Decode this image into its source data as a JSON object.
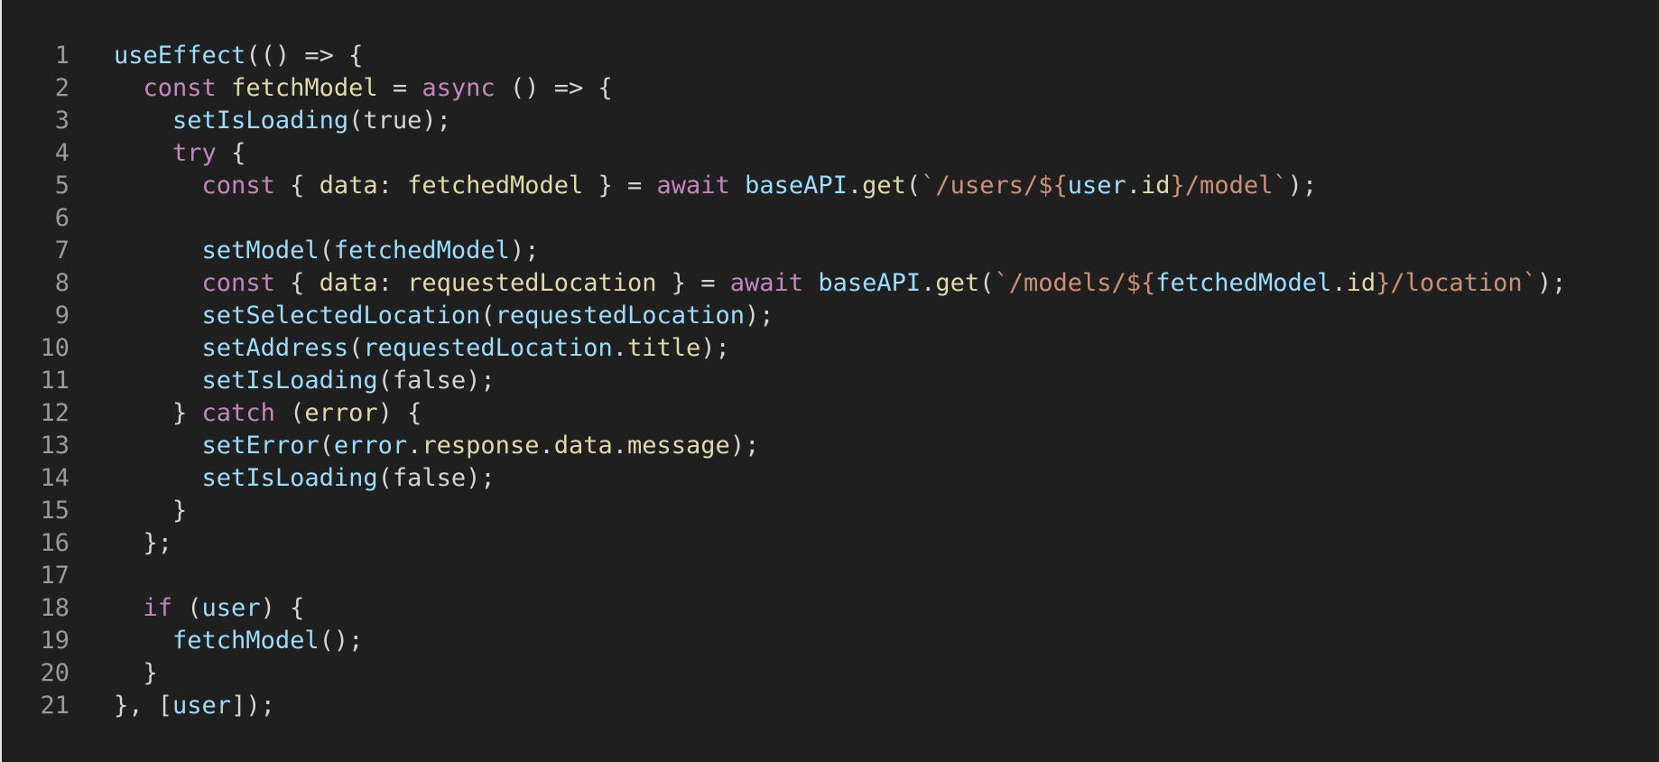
{
  "editor": {
    "lines": [
      {
        "n": "1",
        "tokens": [
          {
            "t": "useEffect",
            "c": "fn"
          },
          {
            "t": "(() => {",
            "c": "pun"
          }
        ]
      },
      {
        "n": "2",
        "tokens": [
          {
            "t": "  ",
            "c": "pun"
          },
          {
            "t": "const",
            "c": "kw"
          },
          {
            "t": " ",
            "c": "pun"
          },
          {
            "t": "fetchModel",
            "c": "var"
          },
          {
            "t": " = ",
            "c": "pun"
          },
          {
            "t": "async",
            "c": "kw"
          },
          {
            "t": " () => {",
            "c": "pun"
          }
        ]
      },
      {
        "n": "3",
        "tokens": [
          {
            "t": "    ",
            "c": "pun"
          },
          {
            "t": "setIsLoading",
            "c": "fn"
          },
          {
            "t": "(true);",
            "c": "pun"
          }
        ]
      },
      {
        "n": "4",
        "tokens": [
          {
            "t": "    ",
            "c": "pun"
          },
          {
            "t": "try",
            "c": "kw"
          },
          {
            "t": " {",
            "c": "pun"
          }
        ]
      },
      {
        "n": "5",
        "tokens": [
          {
            "t": "      ",
            "c": "pun"
          },
          {
            "t": "const",
            "c": "kw"
          },
          {
            "t": " { ",
            "c": "pun"
          },
          {
            "t": "data",
            "c": "var"
          },
          {
            "t": ": ",
            "c": "pun"
          },
          {
            "t": "fetchedModel",
            "c": "var"
          },
          {
            "t": " } = ",
            "c": "pun"
          },
          {
            "t": "await",
            "c": "kw"
          },
          {
            "t": " ",
            "c": "pun"
          },
          {
            "t": "baseAPI",
            "c": "fn"
          },
          {
            "t": ".",
            "c": "pun"
          },
          {
            "t": "get",
            "c": "var"
          },
          {
            "t": "(",
            "c": "pun"
          },
          {
            "t": "`/users/${",
            "c": "str"
          },
          {
            "t": "user",
            "c": "fn"
          },
          {
            "t": ".",
            "c": "pun"
          },
          {
            "t": "id",
            "c": "var"
          },
          {
            "t": "}/model`",
            "c": "str"
          },
          {
            "t": ");",
            "c": "pun"
          }
        ]
      },
      {
        "n": "6",
        "tokens": []
      },
      {
        "n": "7",
        "tokens": [
          {
            "t": "      ",
            "c": "pun"
          },
          {
            "t": "setModel",
            "c": "fn"
          },
          {
            "t": "(",
            "c": "pun"
          },
          {
            "t": "fetchedModel",
            "c": "fn"
          },
          {
            "t": ");",
            "c": "pun"
          }
        ]
      },
      {
        "n": "8",
        "tokens": [
          {
            "t": "      ",
            "c": "pun"
          },
          {
            "t": "const",
            "c": "kw"
          },
          {
            "t": " { ",
            "c": "pun"
          },
          {
            "t": "data",
            "c": "var"
          },
          {
            "t": ": ",
            "c": "pun"
          },
          {
            "t": "requestedLocation",
            "c": "var"
          },
          {
            "t": " } = ",
            "c": "pun"
          },
          {
            "t": "await",
            "c": "kw"
          },
          {
            "t": " ",
            "c": "pun"
          },
          {
            "t": "baseAPI",
            "c": "fn"
          },
          {
            "t": ".",
            "c": "pun"
          },
          {
            "t": "get",
            "c": "var"
          },
          {
            "t": "(",
            "c": "pun"
          },
          {
            "t": "`/models/${",
            "c": "str"
          },
          {
            "t": "fetchedModel",
            "c": "fn"
          },
          {
            "t": ".",
            "c": "pun"
          },
          {
            "t": "id",
            "c": "var"
          },
          {
            "t": "}/location`",
            "c": "str"
          },
          {
            "t": ");",
            "c": "pun"
          }
        ]
      },
      {
        "n": "9",
        "tokens": [
          {
            "t": "      ",
            "c": "pun"
          },
          {
            "t": "setSelectedLocation",
            "c": "fn"
          },
          {
            "t": "(",
            "c": "pun"
          },
          {
            "t": "requestedLocation",
            "c": "fn"
          },
          {
            "t": ");",
            "c": "pun"
          }
        ]
      },
      {
        "n": "10",
        "tokens": [
          {
            "t": "      ",
            "c": "pun"
          },
          {
            "t": "setAddress",
            "c": "fn"
          },
          {
            "t": "(",
            "c": "pun"
          },
          {
            "t": "requestedLocation",
            "c": "fn"
          },
          {
            "t": ".",
            "c": "pun"
          },
          {
            "t": "title",
            "c": "var"
          },
          {
            "t": ");",
            "c": "pun"
          }
        ]
      },
      {
        "n": "11",
        "tokens": [
          {
            "t": "      ",
            "c": "pun"
          },
          {
            "t": "setIsLoading",
            "c": "fn"
          },
          {
            "t": "(false);",
            "c": "pun"
          }
        ]
      },
      {
        "n": "12",
        "tokens": [
          {
            "t": "    } ",
            "c": "pun"
          },
          {
            "t": "catch",
            "c": "kw"
          },
          {
            "t": " (",
            "c": "pun"
          },
          {
            "t": "error",
            "c": "var"
          },
          {
            "t": ") {",
            "c": "pun"
          }
        ]
      },
      {
        "n": "13",
        "tokens": [
          {
            "t": "      ",
            "c": "pun"
          },
          {
            "t": "setError",
            "c": "fn"
          },
          {
            "t": "(",
            "c": "pun"
          },
          {
            "t": "error",
            "c": "fn"
          },
          {
            "t": ".",
            "c": "pun"
          },
          {
            "t": "response",
            "c": "var"
          },
          {
            "t": ".",
            "c": "pun"
          },
          {
            "t": "data",
            "c": "var"
          },
          {
            "t": ".",
            "c": "pun"
          },
          {
            "t": "message",
            "c": "var"
          },
          {
            "t": ");",
            "c": "pun"
          }
        ]
      },
      {
        "n": "14",
        "tokens": [
          {
            "t": "      ",
            "c": "pun"
          },
          {
            "t": "setIsLoading",
            "c": "fn"
          },
          {
            "t": "(false);",
            "c": "pun"
          }
        ]
      },
      {
        "n": "15",
        "tokens": [
          {
            "t": "    }",
            "c": "pun"
          }
        ]
      },
      {
        "n": "16",
        "tokens": [
          {
            "t": "  };",
            "c": "pun"
          }
        ]
      },
      {
        "n": "17",
        "tokens": []
      },
      {
        "n": "18",
        "tokens": [
          {
            "t": "  ",
            "c": "pun"
          },
          {
            "t": "if",
            "c": "kw"
          },
          {
            "t": " (",
            "c": "pun"
          },
          {
            "t": "user",
            "c": "fn"
          },
          {
            "t": ") {",
            "c": "pun"
          }
        ]
      },
      {
        "n": "19",
        "tokens": [
          {
            "t": "    ",
            "c": "pun"
          },
          {
            "t": "fetchModel",
            "c": "fn"
          },
          {
            "t": "();",
            "c": "pun"
          }
        ]
      },
      {
        "n": "20",
        "tokens": [
          {
            "t": "  }",
            "c": "pun"
          }
        ]
      },
      {
        "n": "21",
        "tokens": [
          {
            "t": "}, [",
            "c": "pun"
          },
          {
            "t": "user",
            "c": "fn"
          },
          {
            "t": "]);",
            "c": "pun"
          }
        ]
      }
    ]
  }
}
